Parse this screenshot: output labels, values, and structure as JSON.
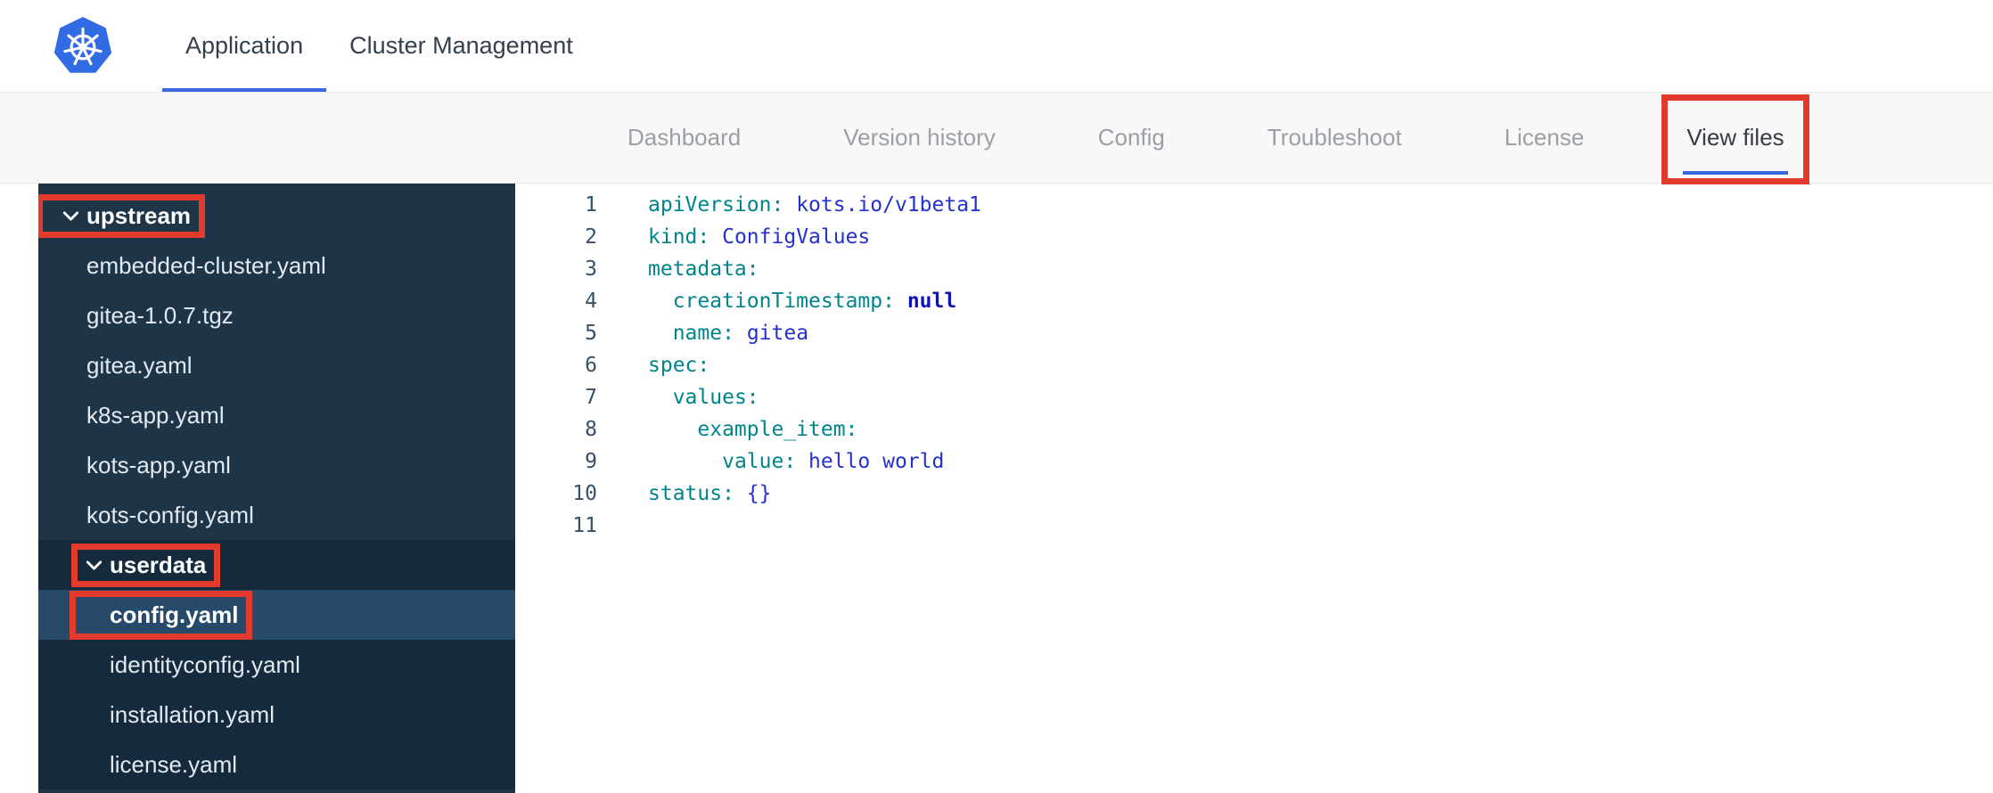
{
  "header": {
    "logo": "kubernetes-logo",
    "tabs": [
      {
        "label": "Application",
        "active": true
      },
      {
        "label": "Cluster Management",
        "active": false
      }
    ]
  },
  "subnav": {
    "tabs": [
      {
        "label": "Dashboard",
        "active": false,
        "annotated": false
      },
      {
        "label": "Version history",
        "active": false,
        "annotated": false
      },
      {
        "label": "Config",
        "active": false,
        "annotated": false
      },
      {
        "label": "Troubleshoot",
        "active": false,
        "annotated": false
      },
      {
        "label": "License",
        "active": false,
        "annotated": false
      },
      {
        "label": "View files",
        "active": true,
        "annotated": true
      }
    ]
  },
  "file_tree": [
    {
      "type": "folder",
      "label": "upstream",
      "level": 0,
      "expanded": true,
      "annotated": true
    },
    {
      "type": "file",
      "label": "embedded-cluster.yaml",
      "level": 1
    },
    {
      "type": "file",
      "label": "gitea-1.0.7.tgz",
      "level": 1
    },
    {
      "type": "file",
      "label": "gitea.yaml",
      "level": 1
    },
    {
      "type": "file",
      "label": "k8s-app.yaml",
      "level": 1
    },
    {
      "type": "file",
      "label": "kots-app.yaml",
      "level": 1
    },
    {
      "type": "file",
      "label": "kots-config.yaml",
      "level": 1
    },
    {
      "type": "folder",
      "label": "userdata",
      "level": 1,
      "expanded": true,
      "annotated": true,
      "group": "userdata"
    },
    {
      "type": "file",
      "label": "config.yaml",
      "level": 2,
      "selected": true,
      "annotated": true,
      "group": "userdata"
    },
    {
      "type": "file",
      "label": "identityconfig.yaml",
      "level": 2,
      "group": "userdata"
    },
    {
      "type": "file",
      "label": "installation.yaml",
      "level": 2,
      "group": "userdata"
    },
    {
      "type": "file",
      "label": "license.yaml",
      "level": 2,
      "group": "userdata"
    }
  ],
  "editor": {
    "lines": [
      {
        "num": "1",
        "tokens": [
          [
            "key",
            "apiVersion:"
          ],
          [
            "plain",
            " "
          ],
          [
            "val",
            "kots.io/v1beta1"
          ]
        ]
      },
      {
        "num": "2",
        "tokens": [
          [
            "key",
            "kind:"
          ],
          [
            "plain",
            " "
          ],
          [
            "val",
            "ConfigValues"
          ]
        ]
      },
      {
        "num": "3",
        "tokens": [
          [
            "key",
            "metadata:"
          ]
        ]
      },
      {
        "num": "4",
        "tokens": [
          [
            "plain",
            "  "
          ],
          [
            "key",
            "creationTimestamp:"
          ],
          [
            "plain",
            " "
          ],
          [
            "null",
            "null"
          ]
        ]
      },
      {
        "num": "5",
        "tokens": [
          [
            "plain",
            "  "
          ],
          [
            "key",
            "name:"
          ],
          [
            "plain",
            " "
          ],
          [
            "val",
            "gitea"
          ]
        ]
      },
      {
        "num": "6",
        "tokens": [
          [
            "key",
            "spec:"
          ]
        ]
      },
      {
        "num": "7",
        "tokens": [
          [
            "plain",
            "  "
          ],
          [
            "key",
            "values:"
          ]
        ]
      },
      {
        "num": "8",
        "tokens": [
          [
            "plain",
            "    "
          ],
          [
            "key",
            "example_item:"
          ]
        ]
      },
      {
        "num": "9",
        "tokens": [
          [
            "plain",
            "      "
          ],
          [
            "key",
            "value:"
          ],
          [
            "plain",
            " "
          ],
          [
            "val",
            "hello world"
          ]
        ]
      },
      {
        "num": "10",
        "tokens": [
          [
            "key",
            "status:"
          ],
          [
            "plain",
            " "
          ],
          [
            "val",
            "{}"
          ]
        ]
      },
      {
        "num": "11",
        "tokens": []
      }
    ]
  },
  "colors": {
    "accent_blue": "#3b66e0",
    "annotation_red": "#e23b2e",
    "sidebar_bg": "#1e3447",
    "sidebar_group_bg": "#152a3c",
    "selected_row_bg": "#27496a",
    "subnav_bg": "#f8f8f8",
    "inactive_tab_text": "#9aa0a6",
    "yaml_key": "#00848c",
    "yaml_value": "#2431cf",
    "yaml_null": "#0f12b5",
    "logo_blue": "#326ce5"
  }
}
